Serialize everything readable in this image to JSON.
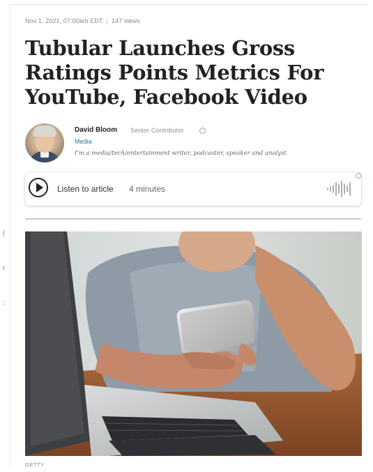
{
  "article": {
    "date": "Nov 1, 2021, 07:00am EDT",
    "separator": "|",
    "views": "147 views",
    "title": "Tubular Launches Gross Ratings Points Metrics For YouTube, Facebook Video"
  },
  "author": {
    "name": "David Bloom",
    "role": "Senior Contributor",
    "section": "Media",
    "bio": "I'm a media/tech/entertainment writer, podcaster, speaker and analyst"
  },
  "audio_player": {
    "label": "Listen to article",
    "duration": "4 minutes"
  },
  "image": {
    "credit": "GETTY"
  },
  "icons": {
    "play": "play-icon",
    "waveform": "waveform-icon",
    "info": "info-icon"
  },
  "colors": {
    "section_link": "#2a7a9a",
    "title": "#222222",
    "meta": "#8a8a8a"
  }
}
